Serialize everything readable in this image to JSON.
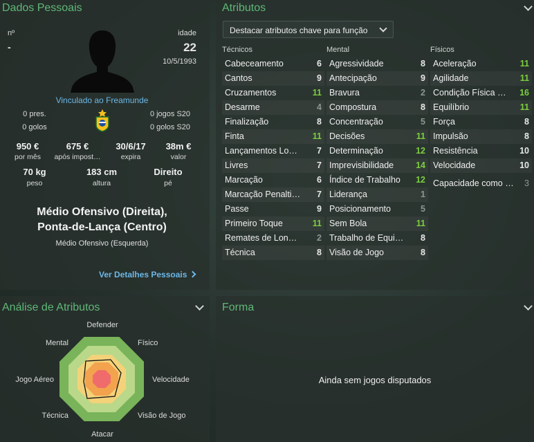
{
  "personal": {
    "title": "Dados Pessoais",
    "number_label": "nº",
    "number_value": "-",
    "age_label": "idade",
    "age_value": "22",
    "birth_date": "10/5/1993",
    "linked_to": "Vinculado ao Freamunde",
    "left_stats": [
      "0 pres.",
      "0 golos"
    ],
    "right_stats": [
      "0 jogos S20",
      "0 golos S20"
    ],
    "money": [
      {
        "value": "950 €",
        "label": "por mês"
      },
      {
        "value": "675 €",
        "label": "após impost…"
      },
      {
        "value": "30/6/17",
        "label": "expira"
      },
      {
        "value": "38m €",
        "label": "valor"
      }
    ],
    "physical": [
      {
        "value": "70 kg",
        "label": "peso"
      },
      {
        "value": "183 cm",
        "label": "altura"
      },
      {
        "value": "Direito",
        "label": "pé"
      }
    ],
    "position_main_1": "Médio Ofensivo (Direita),",
    "position_main_2": "Ponta-de-Lança (Centro)",
    "position_secondary": "Médio Ofensivo (Esquerda)",
    "details_link": "Ver Detalhes Pessoais"
  },
  "attributes": {
    "title": "Atributos",
    "dropdown_label": "Destacar atributos chave para função",
    "headers": [
      "Técnicos",
      "Mental",
      "Físicos"
    ],
    "technical": [
      {
        "name": "Cabeceamento",
        "value": "6"
      },
      {
        "name": "Cantos",
        "value": "9"
      },
      {
        "name": "Cruzamentos",
        "value": "11"
      },
      {
        "name": "Desarme",
        "value": "4"
      },
      {
        "name": "Finalização",
        "value": "8"
      },
      {
        "name": "Finta",
        "value": "11"
      },
      {
        "name": "Lançamentos Lo…",
        "value": "7"
      },
      {
        "name": "Livres",
        "value": "7"
      },
      {
        "name": "Marcação",
        "value": "6"
      },
      {
        "name": "Marcação Penalti…",
        "value": "7"
      },
      {
        "name": "Passe",
        "value": "9"
      },
      {
        "name": "Primeiro Toque",
        "value": "11"
      },
      {
        "name": "Remates de Lon…",
        "value": "2"
      },
      {
        "name": "Técnica",
        "value": "8"
      }
    ],
    "mental": [
      {
        "name": "Agressividade",
        "value": "8"
      },
      {
        "name": "Antecipação",
        "value": "9"
      },
      {
        "name": "Bravura",
        "value": "2"
      },
      {
        "name": "Compostura",
        "value": "8"
      },
      {
        "name": "Concentração",
        "value": "5"
      },
      {
        "name": "Decisões",
        "value": "11"
      },
      {
        "name": "Determinação",
        "value": "12"
      },
      {
        "name": "Imprevisibilidade",
        "value": "14"
      },
      {
        "name": "Índice de Trabalho",
        "value": "12"
      },
      {
        "name": "Liderança",
        "value": "1"
      },
      {
        "name": "Posicionamento",
        "value": "5"
      },
      {
        "name": "Sem Bola",
        "value": "11"
      },
      {
        "name": "Trabalho de Equi…",
        "value": "8"
      },
      {
        "name": "Visão de Jogo",
        "value": "8"
      }
    ],
    "physical": [
      {
        "name": "Aceleração",
        "value": "11"
      },
      {
        "name": "Agilidade",
        "value": "11"
      },
      {
        "name": "Condição Física …",
        "value": "16"
      },
      {
        "name": "Equilíbrio",
        "value": "11"
      },
      {
        "name": "Força",
        "value": "8"
      },
      {
        "name": "Impulsão",
        "value": "8"
      },
      {
        "name": "Resistência",
        "value": "10"
      },
      {
        "name": "Velocidade",
        "value": "10"
      }
    ],
    "ability": {
      "name": "Capacidade como …",
      "value": "3"
    }
  },
  "analysis": {
    "title": "Análise de Atributos",
    "labels": {
      "defender": "Defender",
      "fisico": "Físico",
      "velocidade": "Velocidade",
      "visao": "Visão de Jogo",
      "atacar": "Atacar",
      "tecnica": "Técnica",
      "aereo": "Jogo Aéreo",
      "mental": "Mental"
    },
    "colors": {
      "outer": "#79b35a",
      "mid": "#b9d889",
      "inner": "#f3d27a",
      "core": "#f3a24e",
      "center": "#f06b6b"
    }
  },
  "form": {
    "title": "Forma",
    "empty_text": "Ainda sem jogos disputados"
  }
}
